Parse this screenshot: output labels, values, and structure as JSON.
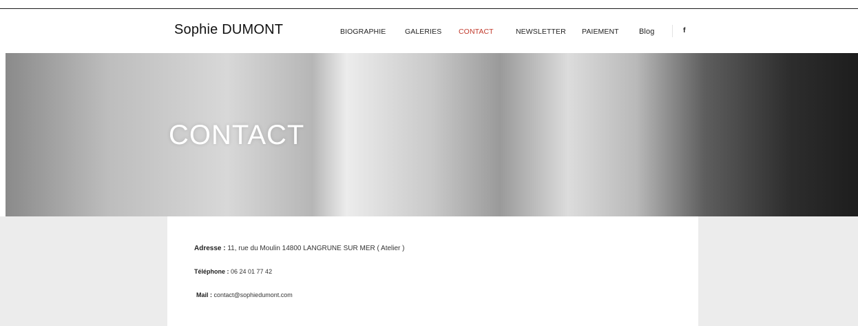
{
  "header": {
    "logo": "Sophie DUMONT",
    "nav": [
      {
        "label": "BIOGRAPHIE",
        "active": false
      },
      {
        "label": "GALERIES",
        "active": false
      },
      {
        "label": "CONTACT",
        "active": true
      },
      {
        "label": "NEWSLETTER",
        "active": false
      },
      {
        "label": "PAIEMENT",
        "active": false
      },
      {
        "label": "Blog",
        "active": false
      }
    ],
    "social_icon": "f",
    "social_icon_name": "facebook-icon"
  },
  "hero": {
    "title": "CONTACT"
  },
  "contact": {
    "address_label": "Adresse :",
    "address_value": " 11, rue du Moulin 14800 LANGRUNE SUR MER ( Atelier )",
    "phone_label": "Téléphone :",
    "phone_value": " 06 24 01 77 42",
    "mail_label": "Mail :",
    "mail_value": " contact@sophiedumont.com"
  },
  "colors": {
    "accent": "#c0392b",
    "band": "#ececec"
  }
}
